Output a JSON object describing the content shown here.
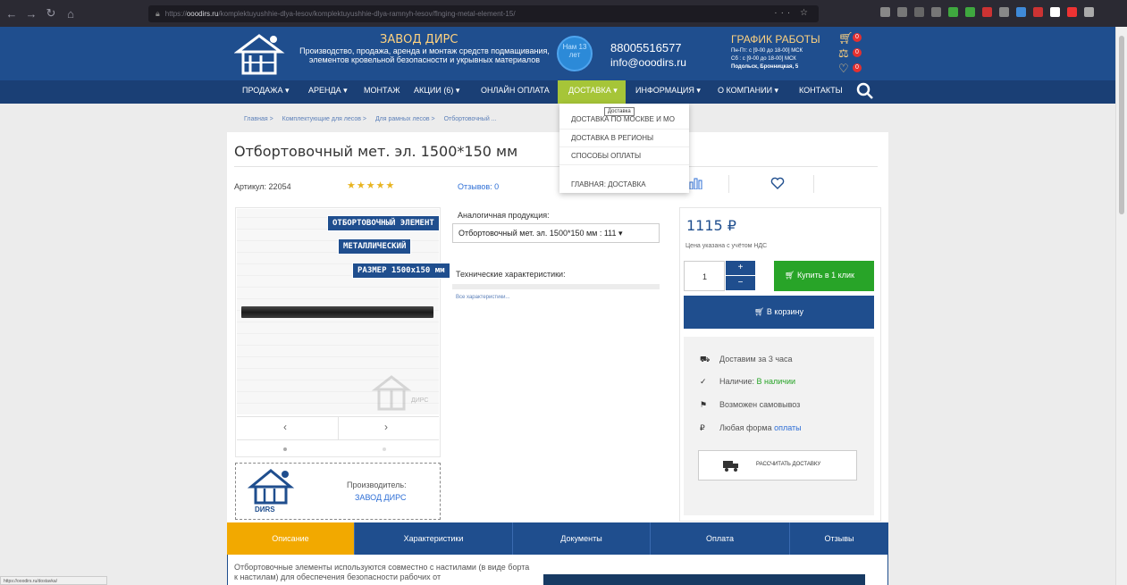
{
  "browser": {
    "url_host": "ooodirs.ru",
    "url_path": "/komplektuyushhie-dlya-lesov/komplektuyushhie-dlya-ramnyh-lesov/flnging-metal-element-15/",
    "url_prefix": "https://"
  },
  "header": {
    "brand": "ЗАВОД ДИРС",
    "tagline": "Производство, продажа, аренда и монтаж средств подмащивания, элементов кровельной безопасности и укрывных материалов",
    "years_badge": "Нам 13 лет",
    "phone": "88005516577",
    "email": "info@ooodirs.ru",
    "schedule_title": "ГРАФИК РАБОТЫ",
    "schedule_weekdays": "Пн-Пт: с [9-00 до 18-00] МСК",
    "schedule_saturday": "Сб : с [9-00 до 18-00] МСК",
    "schedule_address": "Подольск, Бронницкая, 5",
    "cart_count": "0",
    "compare_count": "0",
    "favorites_count": "0"
  },
  "nav": {
    "items": [
      "ПРОДАЖА ▾",
      "АРЕНДА ▾",
      "МОНТАЖ",
      "АКЦИИ (6) ▾",
      "ОНЛАЙН ОПЛАТА",
      "ДОСТАВКА ▾",
      "ИНФОРМАЦИЯ ▾",
      "О КОМПАНИИ ▾",
      "КОНТАКТЫ"
    ]
  },
  "dropdown": {
    "items": [
      "ДОСТАВКА ПО МОСКВЕ И МО",
      "ДОСТАВКА В РЕГИОНЫ",
      "СПОСОБЫ ОПЛАТЫ",
      "ГЛАВНАЯ: ДОСТАВКА"
    ],
    "tooltip": "Доставка"
  },
  "breadcrumb": [
    "Главная  >",
    "Комплектующие для лесов  >",
    "Для рамных лесов  >",
    "Отбортовочный ..."
  ],
  "product": {
    "title": "Отбортовочный мет. эл. 1500*150 мм",
    "article": "Артикул: 22054",
    "stars": "★★★★★",
    "reviews": "Отзывов: 0",
    "image_labels": [
      "ОТБОРТОВОЧНЫЙ ЭЛЕМЕНТ",
      "МЕТАЛЛИЧЕСКИЙ",
      "РАЗМЕР 1500х150 мм"
    ],
    "watermark": "ДИРС",
    "gallery_prev": "‹",
    "gallery_next": "›",
    "maker_label": "Производитель:",
    "maker_name": "ЗАВОД ДИРС",
    "maker_logo_text": "DИRS",
    "analog_label": "Аналогичная продукция:",
    "analog_value": "Отбортовочный мет. эл. 1500*150 мм : 111 ▾",
    "tech_label": "Технические характеристики:",
    "all_chars": "Все характеристики...",
    "price": "1115 ₽",
    "vat_note": "Цена указана с учётом НДС",
    "qty": "1",
    "qty_plus": "+",
    "qty_minus": "−",
    "oneclick": "Купить в 1 клик",
    "to_cart": "В корзину",
    "info_delivery": "Доставим за 3 часа",
    "info_stock_label": "Наличие:",
    "info_stock_value": "В наличии",
    "info_pickup": "Возможен самовывоз",
    "info_payment_prefix": "Любая форма",
    "info_payment_link": "оплаты",
    "calc_delivery": "РАССЧИТАТЬ ДОСТАВКУ"
  },
  "tabs": [
    "Описание",
    "Характеристики",
    "Документы",
    "Оплата",
    "Отзывы"
  ],
  "description": "Отбортовочные элементы используются совместно с настилами (в виде борта к настилам) для обеспечения безопасности рабочих от",
  "status_url": "https://ooodirs.ru/dostavka/",
  "colors": {
    "header_blue": "#1f4e8e",
    "nav_active": "#a6c538",
    "accent_orange": "#f2a900",
    "buy_green": "#28a428",
    "brand_yellow": "#ffd27f"
  }
}
